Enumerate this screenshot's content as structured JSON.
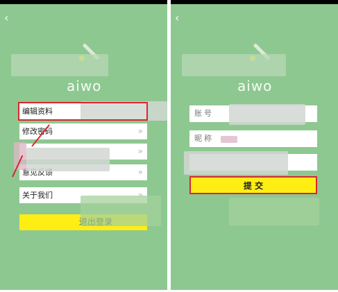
{
  "left_screen": {
    "back_icon": "chevron-left",
    "logo_text": "aiwo",
    "menu": [
      {
        "label": "编辑资料"
      },
      {
        "label": "修改密码"
      },
      {
        "label": ""
      },
      {
        "label": "意见反馈"
      },
      {
        "label": "关于我们"
      }
    ],
    "chevron": "»",
    "logout_label": "退出登录"
  },
  "right_screen": {
    "back_icon": "chevron-left",
    "logo_text": "aiwo",
    "account_label": "账号",
    "nickname_label": "昵称",
    "submit_label": "提 交"
  },
  "annotation_color": "#d8262e",
  "accent_yellow": "#ffee14",
  "background_green": "#8dc891"
}
